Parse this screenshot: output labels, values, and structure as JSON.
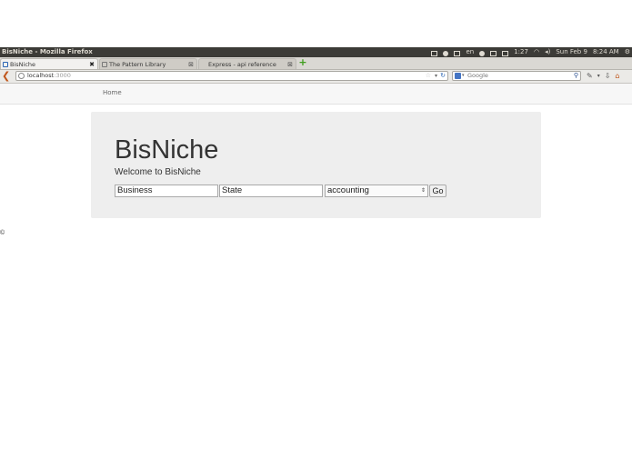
{
  "window": {
    "title": "BisNiche - Mozilla Firefox"
  },
  "panel": {
    "keyboard_layout": "en",
    "battery_time": "1:27",
    "date": "Sun Feb 9",
    "time": "8:24 AM",
    "icons": [
      "compose-icon",
      "network-icon",
      "keyboard-icon",
      "cloud-icon",
      "mail-icon",
      "battery-icon",
      "wifi-icon",
      "volume-icon",
      "gear-icon"
    ]
  },
  "tabs": [
    {
      "label": "BisNiche",
      "active": true
    },
    {
      "label": "The Pattern Library",
      "active": false
    },
    {
      "label": "Express - api reference",
      "active": false
    }
  ],
  "navbar": {
    "url_host": "localhost",
    "url_port": ":3000",
    "search_placeholder": "Google"
  },
  "page": {
    "nav": {
      "home": "Home"
    },
    "hero": {
      "title": "BisNiche",
      "subtitle": "Welcome to BisNiche",
      "business_value": "Business",
      "state_value": "State",
      "category_selected": "accounting",
      "go_label": "Go"
    },
    "footer": "©"
  },
  "colors": {
    "panel_bg": "#3c3b37",
    "hero_bg": "#eeeeee",
    "accent_orange": "#c0561c"
  }
}
